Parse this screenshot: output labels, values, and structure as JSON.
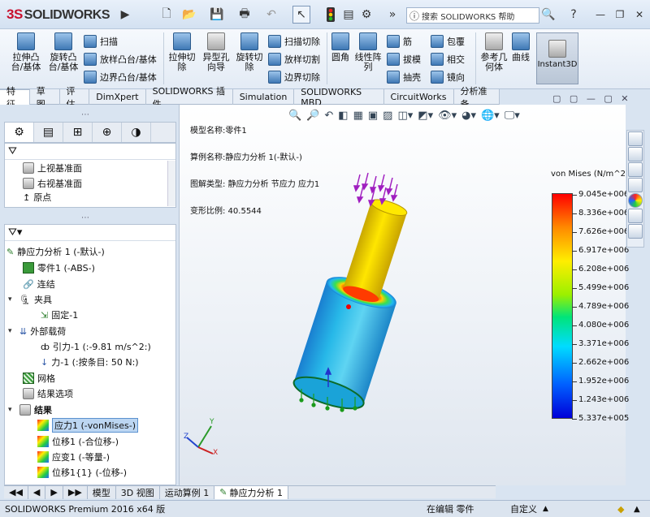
{
  "app": {
    "brand_ds": "3S",
    "brand_name": "SOLIDWORKS"
  },
  "titlebar": {
    "search_text": "搜索 SOLIDWORKS 帮助",
    "help": "?"
  },
  "ribbon": {
    "items": [
      {
        "label": "拉伸凸\n台/基体"
      },
      {
        "label": "旋转凸\n台/基体"
      },
      {
        "label": "扫描"
      },
      {
        "label": "放样凸台/基体"
      },
      {
        "label": "边界凸台/基体"
      },
      {
        "label": "拉伸切\n除"
      },
      {
        "label": "异型孔\n向导"
      },
      {
        "label": "旋转切\n除"
      },
      {
        "label": "扫描切除"
      },
      {
        "label": "放样切割"
      },
      {
        "label": "边界切除"
      },
      {
        "label": "圆角"
      },
      {
        "label": "线性阵\n列"
      },
      {
        "label": "筋"
      },
      {
        "label": "拔模"
      },
      {
        "label": "抽壳"
      },
      {
        "label": "包覆"
      },
      {
        "label": "相交"
      },
      {
        "label": "镜向"
      },
      {
        "label": "参考几\n何体"
      },
      {
        "label": "曲线"
      },
      {
        "label": "Instant3D"
      }
    ]
  },
  "tabs": [
    "特征",
    "草图",
    "评估",
    "DimXpert",
    "SOLIDWORKS 插件",
    "Simulation",
    "SOLIDWORKS MBD",
    "CircuitWorks",
    "分析准备"
  ],
  "feature_tree_top": [
    "上视基准面",
    "右视基准面",
    "原点"
  ],
  "study_tree": {
    "root": "静应力分析 1 (-默认-)",
    "items": [
      {
        "label": "零件1 (-ABS-)"
      },
      {
        "label": "连结"
      },
      {
        "label": "夹具"
      },
      {
        "label": "固定-1"
      },
      {
        "label": "外部载荷"
      },
      {
        "label": "引力-1 (:-9.81 m/s^2:)"
      },
      {
        "label": "力-1 (:按条目: 50 N:)"
      },
      {
        "label": "网格"
      },
      {
        "label": "结果选项"
      },
      {
        "label": "结果"
      },
      {
        "label": "应力1 (-vonMises-)"
      },
      {
        "label": "位移1 (-合位移-)"
      },
      {
        "label": "应变1 (-等量-)"
      },
      {
        "label": "位移1{1} (-位移-)"
      }
    ]
  },
  "bottom_tabs": [
    "模型",
    "3D 视图",
    "运动算例 1",
    "静应力分析 1"
  ],
  "statusbar": {
    "left": "SOLIDWORKS Premium 2016 x64 版",
    "editing": "在编辑 零件",
    "custom": "自定义"
  },
  "viewport_info": {
    "line1": "模型名称:零件1",
    "line2": "算例名称:静应力分析 1(-默认-)",
    "line3": "图解类型: 静应力分析 节应力 应力1",
    "line4": "变形比例: 40.5544"
  },
  "legend": {
    "title": "von Mises (N/m^2)",
    "values": [
      "9.045e+006",
      "8.336e+006",
      "7.626e+006",
      "6.917e+006",
      "6.208e+006",
      "5.499e+006",
      "4.789e+006",
      "4.080e+006",
      "3.371e+006",
      "2.662e+006",
      "1.952e+006",
      "1.243e+006",
      "5.337e+005"
    ]
  },
  "axes": {
    "x": "X",
    "y": "Y",
    "z": "Z"
  }
}
